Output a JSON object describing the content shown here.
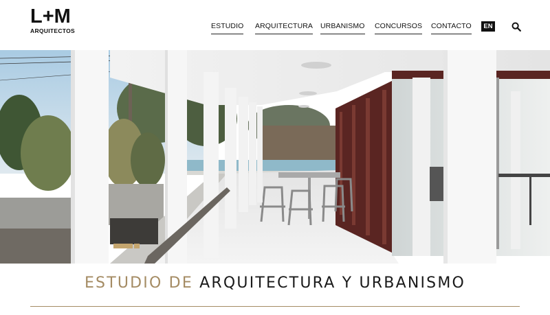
{
  "brand": {
    "mark": "L+M",
    "sub": "ARQUITECTOS"
  },
  "nav": {
    "items": [
      "ESTUDIO",
      "ARQUITECTURA",
      "URBANISMO",
      "CONCURSOS",
      "CONTACTO"
    ]
  },
  "header": {
    "lang_label": "EN",
    "search_icon": "search-icon"
  },
  "hero": {
    "image": "covered-terrace-with-columns-photo"
  },
  "tagline": {
    "accent": "ESTUDIO DE",
    "main": "ARQUITECTURA Y URBANISMO"
  },
  "colors": {
    "accent": "#a48b63",
    "text": "#111111",
    "background": "#ffffff"
  }
}
